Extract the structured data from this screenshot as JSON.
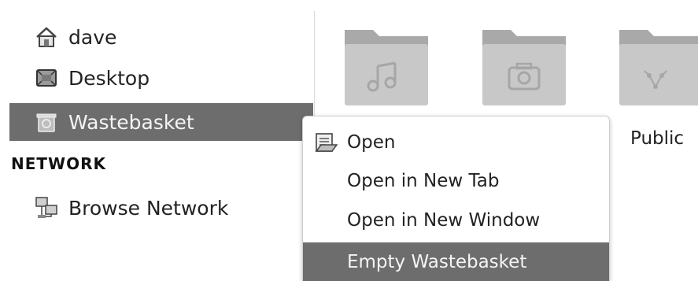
{
  "sidebar": {
    "items": [
      {
        "label": "dave",
        "icon": "home-icon"
      },
      {
        "label": "Desktop",
        "icon": "desktop-icon"
      },
      {
        "label": "Wastebasket",
        "icon": "wastebasket-icon",
        "selected": true
      }
    ],
    "network_header": "NETWORK",
    "network_items": [
      {
        "label": "Browse Network",
        "icon": "network-icon"
      }
    ]
  },
  "folders": [
    {
      "name": "",
      "icon": "music-folder-icon"
    },
    {
      "name": "",
      "icon": "pictures-folder-icon"
    },
    {
      "name": "Public",
      "icon": "public-folder-icon"
    }
  ],
  "context_menu": {
    "items": [
      {
        "label": "Open",
        "icon": "open-icon"
      },
      {
        "label": "Open in New Tab"
      },
      {
        "label": "Open in New Window"
      },
      {
        "label": "Empty Wastebasket",
        "highlighted": true
      }
    ]
  },
  "colors": {
    "selection": "#6d6d6d",
    "folder": "#c8c8c8",
    "folder_tab": "#a9a9a9"
  }
}
